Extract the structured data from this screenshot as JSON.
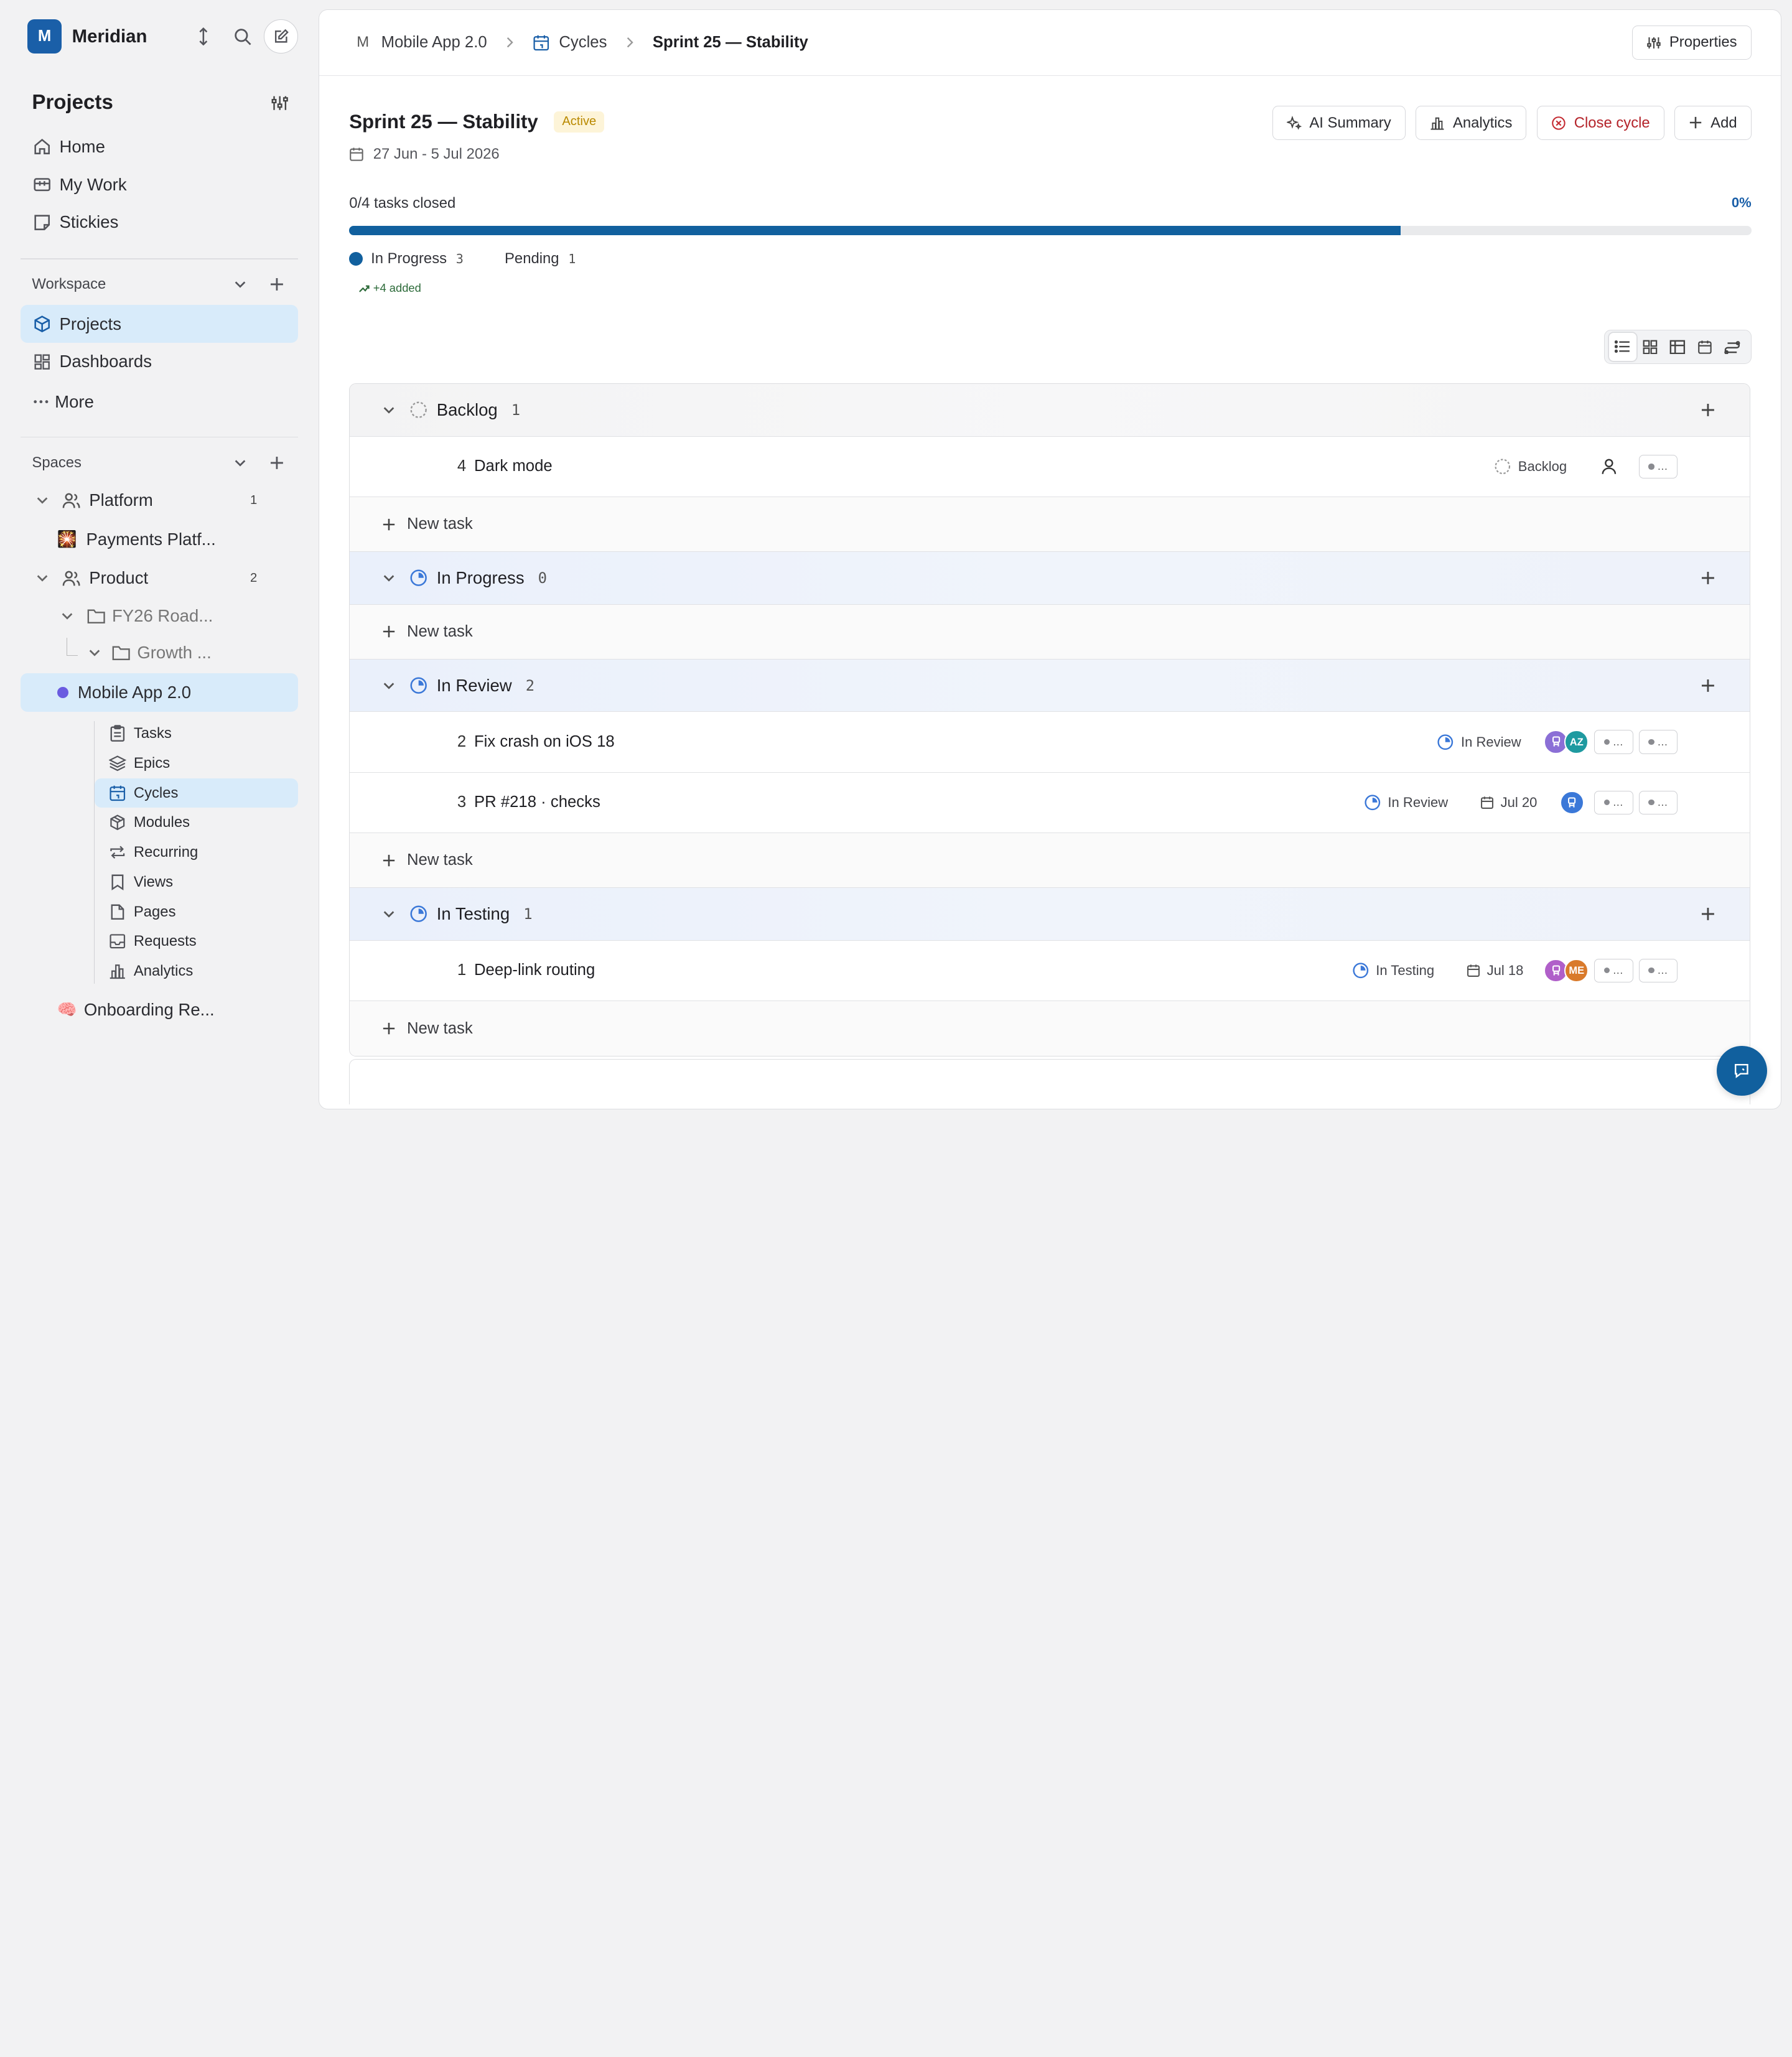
{
  "workspace": {
    "logo_letter": "M",
    "name": "Meridian"
  },
  "sidebar": {
    "projects_title": "Projects",
    "top_nav": [
      {
        "label": "Home",
        "icon": "home-icon"
      },
      {
        "label": "My Work",
        "icon": "briefcase-icon"
      },
      {
        "label": "Stickies",
        "icon": "sticky-note-icon"
      }
    ],
    "workspace_label": "Workspace",
    "workspace_nav": [
      {
        "label": "Projects",
        "icon": "cube-icon",
        "active": true
      },
      {
        "label": "Dashboards",
        "icon": "dashboard-icon",
        "active": false
      },
      {
        "label": "More",
        "icon": "ellipsis-icon",
        "active": false
      }
    ],
    "spaces_label": "Spaces",
    "spaces": {
      "platform": {
        "label": "Platform",
        "count": "1"
      },
      "payments": {
        "label": "Payments Platf...",
        "emoji": "🎇"
      },
      "product": {
        "label": "Product",
        "count": "2"
      },
      "fy26": {
        "label": "FY26 Road..."
      },
      "growth": {
        "label": "Growth ..."
      },
      "mobile": {
        "label": "Mobile App 2.0",
        "color": "#6a5be0"
      },
      "onboarding": {
        "label": "Onboarding Re...",
        "emoji": "🧠"
      }
    },
    "project_menu": [
      {
        "label": "Tasks",
        "icon": "clipboard-icon"
      },
      {
        "label": "Epics",
        "icon": "layers-icon"
      },
      {
        "label": "Cycles",
        "icon": "calendar-icon",
        "active": true
      },
      {
        "label": "Modules",
        "icon": "package-icon"
      },
      {
        "label": "Recurring",
        "icon": "repeat-icon"
      },
      {
        "label": "Views",
        "icon": "bookmark-icon"
      },
      {
        "label": "Pages",
        "icon": "file-icon"
      },
      {
        "label": "Requests",
        "icon": "inbox-icon"
      },
      {
        "label": "Analytics",
        "icon": "bar-chart-icon"
      }
    ]
  },
  "breadcrumb": {
    "project_letter": "M",
    "project": "Mobile App 2.0",
    "section": "Cycles",
    "current": "Sprint 25 — Stability"
  },
  "toolbar": {
    "properties": "Properties"
  },
  "cycle": {
    "title": "Sprint 25 — Stability",
    "status": "Active",
    "dates": "27 Jun - 5 Jul 2026",
    "actions": {
      "ai_summary": "AI Summary",
      "analytics": "Analytics",
      "close": "Close cycle",
      "add": "Add"
    },
    "progress": {
      "label": "0/4 tasks closed",
      "percent_label": "0%",
      "bar_fill": 0.75,
      "legend": [
        {
          "label": "In Progress",
          "count": "3"
        },
        {
          "label": "Pending",
          "count": "1"
        }
      ],
      "added": "+4 added"
    }
  },
  "groups": [
    {
      "name": "Backlog",
      "count": "1",
      "style": "gray",
      "icon": "backlog-icon",
      "tasks": [
        {
          "id": "4",
          "title": "Dark mode",
          "status": "Backlog",
          "status_icon": "backlog-icon"
        }
      ],
      "new_task": "New task"
    },
    {
      "name": "In Progress",
      "count": "0",
      "style": "blue",
      "icon": "in-progress-icon",
      "tasks": [],
      "new_task": "New task"
    },
    {
      "name": "In Review",
      "count": "2",
      "style": "blue",
      "icon": "in-review-icon",
      "tasks": [
        {
          "id": "2",
          "title": "Fix crash on iOS 18",
          "status": "In Review",
          "avatars": [
            "",
            "AZ"
          ]
        },
        {
          "id": "3",
          "title": "PR #218 · checks",
          "status": "In Review",
          "due": "Jul 20",
          "avatars": [
            ""
          ]
        }
      ],
      "new_task": "New task"
    },
    {
      "name": "In Testing",
      "count": "1",
      "style": "blue",
      "icon": "in-testing-icon",
      "tasks": [
        {
          "id": "1",
          "title": "Deep-link routing",
          "status": "In Testing",
          "due": "Jul 18",
          "avatars": [
            "",
            "ME"
          ]
        }
      ],
      "new_task": "New task"
    }
  ],
  "pill_text": "...",
  "colors": {
    "accent": "#11609e",
    "active_badge": "#b98900",
    "danger": "#b4232a",
    "avatar_purple": "#8b6fd6",
    "avatar_teal": "#1f9aa0",
    "avatar_blue": "#3b78d8",
    "avatar_orange": "#d97a2b"
  }
}
